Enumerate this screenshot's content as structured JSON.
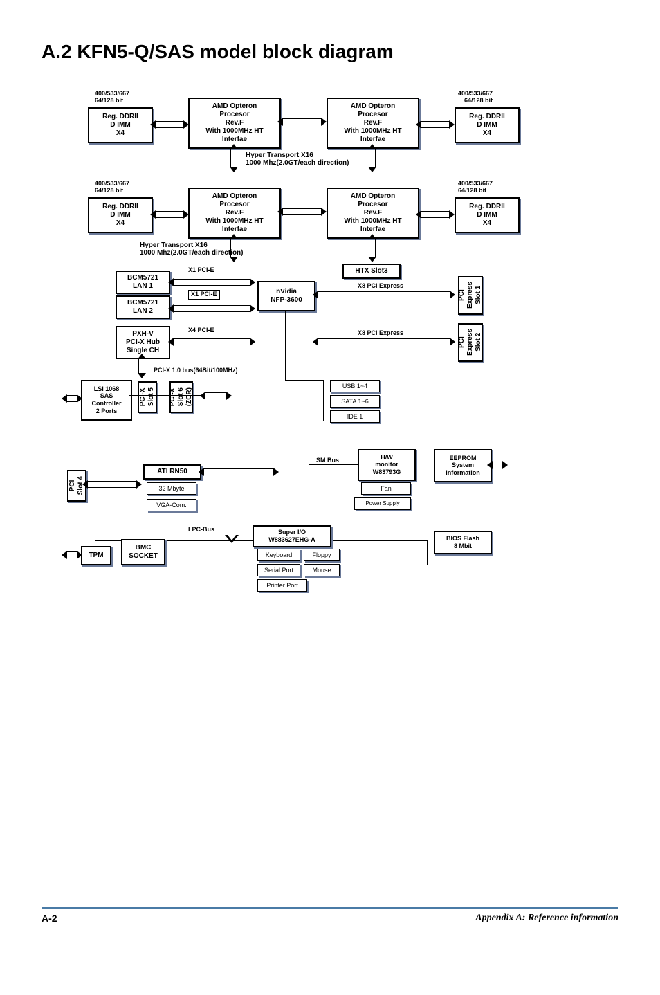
{
  "title": "A.2    KFN5-Q/SAS model block diagram",
  "mem_tl_label": "400/533/667\n64/128 bit",
  "mem_tr_label": "400/533/667\n64/128 bit",
  "mem_ml_label": "400/533/667\n64/128 bit",
  "mem_mr_label": "400/533/667\n64/128 bit",
  "ddr_box": "Reg.  DDRII\nD IMM\nX4",
  "cpu_box": "AMD Opteron\nProcesor\nRev.F\nWith 1000MHz HT\nInterfae",
  "ht16": "Hyper Transport X16\n1000 Mhz(2.0GT/each direction)",
  "htx_slot": "HTX Slot3",
  "lan1": "BCM5721\nLAN 1",
  "lan2": "BCM5721\nLAN 2",
  "x1pcie": "X1 PCI-E",
  "nvidia": "nVidia\nNFP-3600",
  "x8pcie": "X8 PCI Express",
  "pci_express_slot1": "PCI\nExpress\nSlot 1",
  "pci_express_slot2": "PCI\nExpress\nSlot 2",
  "pxhv": "PXH-V\nPCI-X Hub\nSingle CH",
  "x4pcie": "X4 PCI-E",
  "pcix1bus": "PCI-X 1.0 bus(64Bit/100MHz)",
  "lsi": "LSI 1068\nSAS\nController\n2 Ports",
  "pcix_slot5": "PCI-X\nSlot 5",
  "pcix_slot6": "PCI-X\nSlot 6\n(ZCR)",
  "usb": "USB 1~4",
  "sata": "SATA 1~6",
  "ide": "IDE 1",
  "pci_slot4": "PCI\nSlot 4",
  "ati": "ATI RN50",
  "mem32": "32 Mbyte",
  "vga": "VGA-Com.",
  "lpc": "LPC-Bus",
  "tpm": "TPM",
  "bmc": "BMC\nSOCKET",
  "superio": "Super I/O\nW883627EHG-A",
  "keyboard": "Keyboard",
  "floppy": "Floppy",
  "serial": "Serial Port",
  "mouse": "Mouse",
  "printer": "Printer Port",
  "smbus": "SM Bus",
  "hw": "H/W\nmonitor\nW83793G",
  "fan": "Fan",
  "psu": "Power Supply",
  "eeprom": "EEPROM\nSystem\ninformation",
  "bios": "BIOS Flash\n8 Mbit",
  "footer_left": "A-2",
  "footer_right": "Appendix A: Reference information"
}
